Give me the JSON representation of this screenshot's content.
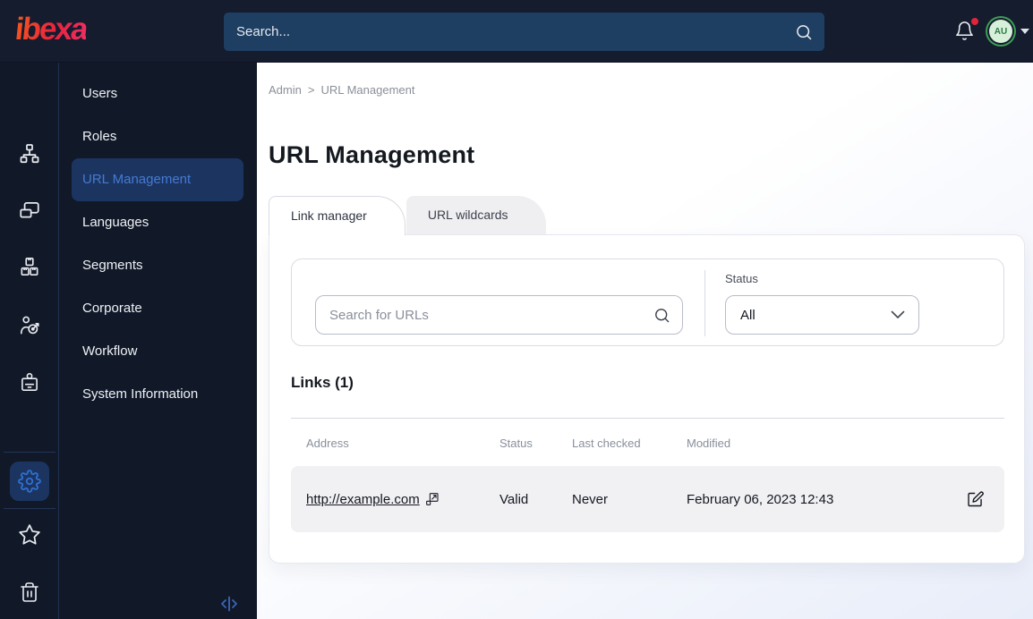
{
  "topbar": {
    "logo_text": "ibexa",
    "search_placeholder": "Search...",
    "avatar_initials": "AU"
  },
  "sidebar": {
    "rail_icons": [
      "sitemap-icon",
      "pages-icon",
      "products-icon",
      "audience-icon",
      "badge-icon",
      "settings-icon",
      "star-icon",
      "trash-icon"
    ],
    "items": [
      {
        "label": "Users",
        "active": false
      },
      {
        "label": "Roles",
        "active": false
      },
      {
        "label": "URL Management",
        "active": true
      },
      {
        "label": "Languages",
        "active": false
      },
      {
        "label": "Segments",
        "active": false
      },
      {
        "label": "Corporate",
        "active": false
      },
      {
        "label": "Workflow",
        "active": false
      },
      {
        "label": "System Information",
        "active": false
      }
    ]
  },
  "breadcrumb": {
    "parent": "Admin",
    "separator": ">",
    "current": "URL Management"
  },
  "page": {
    "title": "URL Management"
  },
  "tabs": [
    {
      "label": "Link manager",
      "active": true
    },
    {
      "label": "URL wildcards",
      "active": false
    }
  ],
  "filters": {
    "search_placeholder": "Search for URLs",
    "status_label": "Status",
    "status_value": "All"
  },
  "links_section": {
    "heading": "Links (1)",
    "table": {
      "headers": [
        "Address",
        "Status",
        "Last checked",
        "Modified"
      ],
      "rows": [
        {
          "address": "http://example.com",
          "status": "Valid",
          "last_checked": "Never",
          "modified": "February 06, 2023 12:43"
        }
      ]
    }
  },
  "colors": {
    "brand_gradient": [
      "#f4581d",
      "#e8233f",
      "#ef2f63"
    ],
    "accent_blue": "#4479d4",
    "active_item_bg": "#1c3560",
    "topbar_bg": "#141c2e",
    "sidebar_bg": "#111929",
    "notification_red": "#e0243c",
    "avatar_green": "#3f9d55"
  }
}
